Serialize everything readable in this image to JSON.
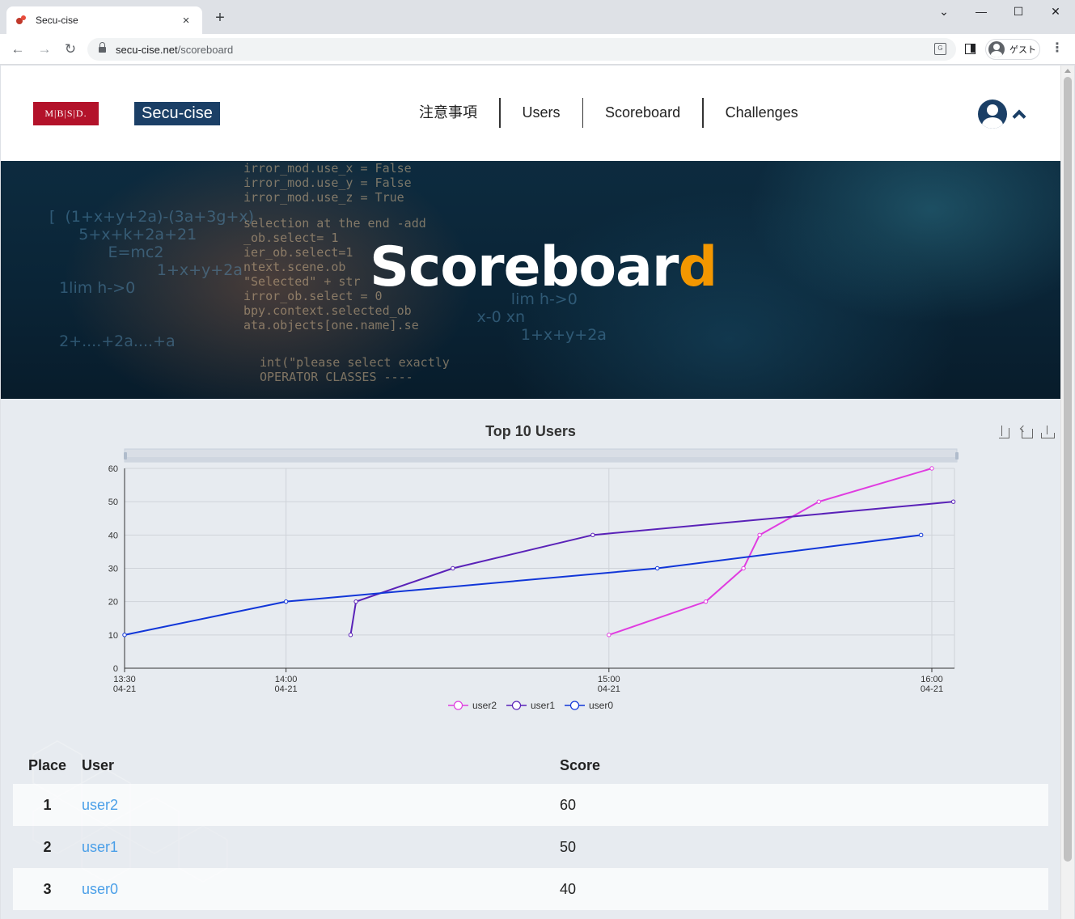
{
  "browser": {
    "tab_title": "Secu-cise",
    "url_host": "secu-cise.net",
    "url_path": "/scoreboard",
    "profile_label": "ゲスト",
    "new_tab": "+",
    "tab_close": "×",
    "back": "←",
    "forward": "→",
    "reload": "↻",
    "minimize": "—",
    "maximize": "☐",
    "close": "✕",
    "tab_list": "⌄",
    "menu": "⋮"
  },
  "header": {
    "logo_text": "M|B|S|D.",
    "brand": "Secu-cise",
    "nav": [
      "注意事項",
      "Users",
      "Scoreboard",
      "Challenges"
    ]
  },
  "hero": {
    "title_main": "Scoreboar",
    "title_accent": "d",
    "accent_color": "#f39700"
  },
  "chart_data": {
    "type": "line",
    "title": "Top 10 Users",
    "x_ticks": [
      "13:30\n04-21",
      "14:00\n04-21",
      "15:00\n04-21",
      "16:00\n04-21"
    ],
    "ylim": [
      0,
      60
    ],
    "y_ticks": [
      0,
      10,
      20,
      30,
      40,
      50,
      60
    ],
    "series": [
      {
        "name": "user2",
        "color": "#e03ce0",
        "points": [
          [
            "15:00",
            10
          ],
          [
            "15:18",
            20
          ],
          [
            "15:25",
            30
          ],
          [
            "15:28",
            40
          ],
          [
            "15:39",
            50
          ],
          [
            "16:00",
            60
          ]
        ]
      },
      {
        "name": "user1",
        "color": "#5a22b8",
        "points": [
          [
            "14:12",
            10
          ],
          [
            "14:13",
            20
          ],
          [
            "14:31",
            30
          ],
          [
            "14:57",
            40
          ],
          [
            "16:04",
            50
          ]
        ]
      },
      {
        "name": "user0",
        "color": "#1136d8",
        "points": [
          [
            "13:30",
            10
          ],
          [
            "14:00",
            20
          ],
          [
            "15:09",
            30
          ],
          [
            "15:58",
            40
          ]
        ]
      }
    ],
    "grid": true,
    "legend": "bottom-center"
  },
  "table": {
    "headers": [
      "Place",
      "User",
      "Score"
    ],
    "rows": [
      {
        "place": "1",
        "user": "user2",
        "score": "60"
      },
      {
        "place": "2",
        "user": "user1",
        "score": "50"
      },
      {
        "place": "3",
        "user": "user0",
        "score": "40"
      }
    ]
  }
}
